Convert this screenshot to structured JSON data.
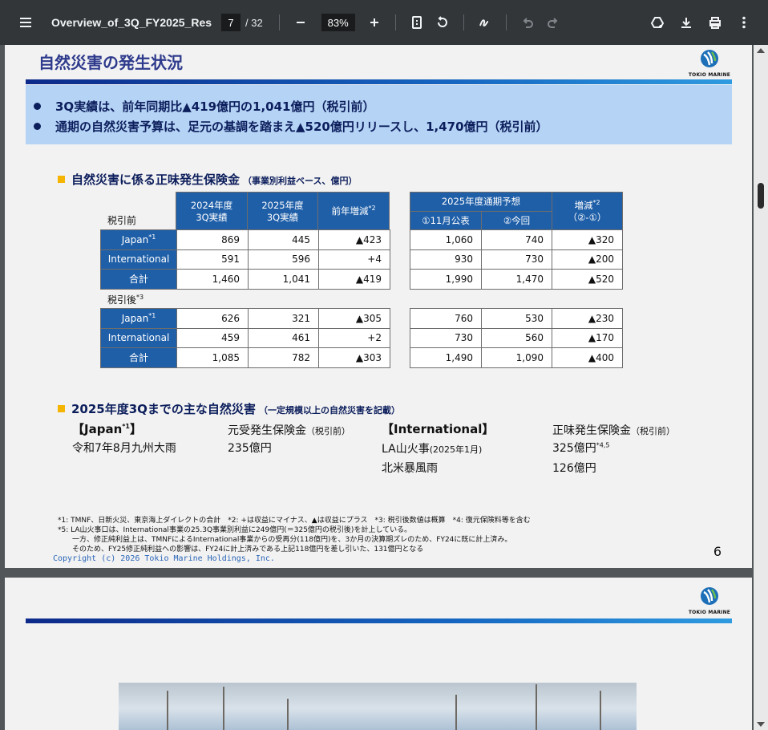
{
  "toolbar": {
    "doc_title": "Overview_of_3Q_FY2025_Res...",
    "current_page": "7",
    "total_pages": "/ 32",
    "zoom": "83%"
  },
  "slide": {
    "title": "自然災害の発生状況",
    "logo_text": "TOKIO MARINE",
    "summary": [
      "3Q実績は、前年同期比▲419億円の1,041億円（税引前）",
      "通期の自然災害予算は、足元の基調を踏まえ▲520億円リリースし、1,470億円（税引前）"
    ],
    "section1": {
      "title": "自然災害に係る正味発生保険金",
      "note": "（事業別利益ベース、億円）",
      "pretax_label": "税引前",
      "aftertax_label": "税引後",
      "aftertax_sup": "*3",
      "headers": {
        "fy2024": "2024年度\n3Q実績",
        "fy2025": "2025年度\n3Q実績",
        "yoy": "前年増減",
        "yoy_sup": "*2",
        "forecast": "2025年度通期予想",
        "nov": "①11月公表",
        "now": "②今回",
        "diff": "増減",
        "diff_sup": "*2",
        "diff_sub": "（②-①）"
      },
      "pretax_rows": [
        {
          "label": "Japan",
          "sup": "*1",
          "a": "869",
          "b": "445",
          "c": "▲423",
          "d": "1,060",
          "e": "740",
          "f": "▲320"
        },
        {
          "label": "International",
          "sup": "",
          "a": "591",
          "b": "596",
          "c": "+4",
          "d": "930",
          "e": "730",
          "f": "▲200"
        },
        {
          "label": "合計",
          "sup": "",
          "a": "1,460",
          "b": "1,041",
          "c": "▲419",
          "d": "1,990",
          "e": "1,470",
          "f": "▲520"
        }
      ],
      "aftertax_rows": [
        {
          "label": "Japan",
          "sup": "*1",
          "a": "626",
          "b": "321",
          "c": "▲305",
          "d": "760",
          "e": "530",
          "f": "▲230"
        },
        {
          "label": "International",
          "sup": "",
          "a": "459",
          "b": "461",
          "c": "+2",
          "d": "730",
          "e": "560",
          "f": "▲170"
        },
        {
          "label": "合計",
          "sup": "",
          "a": "1,085",
          "b": "782",
          "c": "▲303",
          "d": "1,490",
          "e": "1,090",
          "f": "▲400"
        }
      ]
    },
    "section2": {
      "title": "2025年度3Qまでの主な自然災害",
      "note": "（一定規模以上の自然災害を記載）",
      "japan_head": "【Japan",
      "japan_sup": "*1",
      "japan_close": "】",
      "japan_col": "元受発生保険金",
      "japan_col_note": "（税引前）",
      "japan_event": "令和7年8月九州大雨",
      "japan_amount": "235億円",
      "intl_head": "【International】",
      "intl_col": "正味発生保険金",
      "intl_col_note": "（税引前）",
      "intl_event1": "LA山火事",
      "intl_event1_note": "(2025年1月)",
      "intl_amount1": "325億円",
      "intl_amount1_sup": "*4,5",
      "intl_event2": "北米暴風雨",
      "intl_amount2": "126億円"
    },
    "footnotes": [
      "*1: TMNF、日新火災、東京海上ダイレクトの合計　*2: +は収益にマイナス、▲は収益にプラス　*3: 税引後数値は概算　*4: 復元保険料等を含む",
      "*5: LA山火事口は、International事業の25.3Q事業別利益に249億円(＝325億円の税引後)を計上している。",
      "　　一方、修正純利益上は、TMNFによるInternational事業からの受再分(118億円)を、3か月の決算期ズレのため、FY24に既に計上済み。",
      "　　そのため、FY25修正純利益への影響は、FY24に計上済みである上記118億円を差し引いた、131億円となる"
    ],
    "copyright": "Copyright (c) 2026 Tokio Marine Holdings, Inc.",
    "page_number": "6"
  },
  "icons": [
    "menu-icon",
    "fit-page-icon",
    "rotate-icon",
    "annotate-icon",
    "undo-icon",
    "redo-icon",
    "drive-icon",
    "download-icon",
    "print-icon",
    "more-icon"
  ]
}
